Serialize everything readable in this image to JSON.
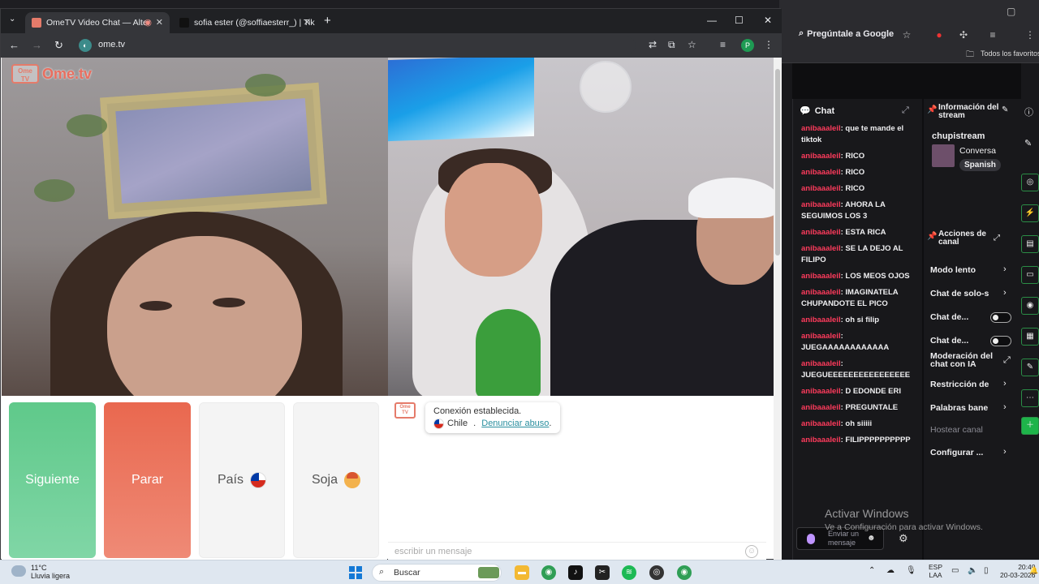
{
  "background_window": {
    "gemini_label": "Pregúntale a Google",
    "bookmarks_label": "Todos los favoritos",
    "chat": {
      "title": "Chat",
      "messages": [
        {
          "user": "anibaaaleil",
          "text": ": que te mande el tiktok"
        },
        {
          "user": "anibaaaleil",
          "text": ": RICO"
        },
        {
          "user": "anibaaaleil",
          "text": ": RICO"
        },
        {
          "user": "anibaaaleil",
          "text": ": RICO"
        },
        {
          "user": "anibaaaleil",
          "text": ": AHORA LA SEGUIMOS LOS 3"
        },
        {
          "user": "anibaaaleil",
          "text": ": ESTA RICA"
        },
        {
          "user": "anibaaaleil",
          "text": ": SE LA DEJO AL FILIPO"
        },
        {
          "user": "anibaaaleil",
          "text": ": LOS MEOS OJOS"
        },
        {
          "user": "anibaaaleil",
          "text": ": IMAGINATELA CHUPANDOTE EL PICO"
        },
        {
          "user": "anibaaaleil",
          "text": ": oh si filip"
        },
        {
          "user": "anibaaaleil",
          "text": ": JUEGAAAAAAAAAAAA"
        },
        {
          "user": "anibaaaleil",
          "text": ": JUEGUEEEEEEEEEEEEEEEE"
        },
        {
          "user": "anibaaaleil",
          "text": ": D EDONDE ERI"
        },
        {
          "user": "anibaaaleil",
          "text": ": PREGUNTALE"
        },
        {
          "user": "anibaaaleil",
          "text": ": oh siiiii"
        },
        {
          "user": "anibaaaleil",
          "text": ": FILIPPPPPPPPPP"
        }
      ],
      "input_placeholder": "Enviar un mensaje"
    },
    "stream_info": {
      "title": "Información del stream",
      "channel": "chupistream",
      "category": "Conversa",
      "language": "Spanish"
    },
    "channel_actions": {
      "title": "Acciones de canal",
      "items": [
        {
          "label": "Modo lento",
          "kind": "chevron"
        },
        {
          "label": "Chat de solo-s",
          "kind": "chevron"
        },
        {
          "label": "Chat de...",
          "kind": "toggle"
        },
        {
          "label": "Chat de...",
          "kind": "toggle"
        },
        {
          "label": "Moderación del chat con IA",
          "kind": "external"
        },
        {
          "label": "Restricción de",
          "kind": "chevron"
        },
        {
          "label": "Palabras bane",
          "kind": "chevron"
        },
        {
          "label": "Hostear canal",
          "kind": "disabled"
        },
        {
          "label": "Configurar ...",
          "kind": "chevron"
        }
      ]
    },
    "activate_windows": {
      "line1": "Activar Windows",
      "line2": "Ve a Configuración para activar Windows."
    }
  },
  "browser": {
    "tabs": [
      {
        "title": "OmeTV Video Chat — Alter",
        "active": true
      },
      {
        "title": "sofia ester (@soffiaesterr_) | Tik",
        "active": false
      }
    ],
    "url": "ome.tv",
    "profile_initial": "P"
  },
  "ometv": {
    "brand": "Ome.tv",
    "brand_badge": "Ome TV",
    "buttons": {
      "next": "Siguiente",
      "stop": "Parar",
      "country": "País",
      "gender": "Soja"
    },
    "chat": {
      "status": "Conexión establecida.",
      "country": "Chile",
      "separator": " . ",
      "report": "Denunciar abuso",
      "report_suffix": ".",
      "input_placeholder": "escribir un mensaje"
    }
  },
  "taskbar": {
    "temperature": "11°C",
    "weather": "Lluvia ligera",
    "search_label": "Buscar",
    "lang_line1": "ESP",
    "lang_line2": "LAA",
    "time": "20:40",
    "date": "20-03-2026"
  },
  "colors": {
    "next_button": "#5fc98a",
    "stop_button": "#e9684f",
    "twitch_username": "#ff3b5c",
    "report_link": "#2a8f9f"
  }
}
